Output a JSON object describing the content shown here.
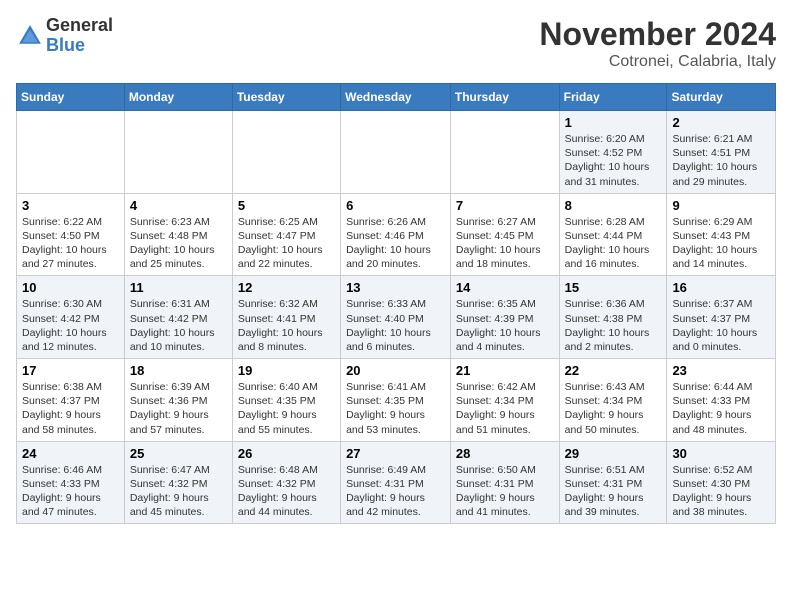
{
  "header": {
    "logo_general": "General",
    "logo_blue": "Blue",
    "month_title": "November 2024",
    "subtitle": "Cotronei, Calabria, Italy"
  },
  "days_of_week": [
    "Sunday",
    "Monday",
    "Tuesday",
    "Wednesday",
    "Thursday",
    "Friday",
    "Saturday"
  ],
  "weeks": [
    [
      {
        "day": "",
        "info": ""
      },
      {
        "day": "",
        "info": ""
      },
      {
        "day": "",
        "info": ""
      },
      {
        "day": "",
        "info": ""
      },
      {
        "day": "",
        "info": ""
      },
      {
        "day": "1",
        "info": "Sunrise: 6:20 AM\nSunset: 4:52 PM\nDaylight: 10 hours and 31 minutes."
      },
      {
        "day": "2",
        "info": "Sunrise: 6:21 AM\nSunset: 4:51 PM\nDaylight: 10 hours and 29 minutes."
      }
    ],
    [
      {
        "day": "3",
        "info": "Sunrise: 6:22 AM\nSunset: 4:50 PM\nDaylight: 10 hours and 27 minutes."
      },
      {
        "day": "4",
        "info": "Sunrise: 6:23 AM\nSunset: 4:48 PM\nDaylight: 10 hours and 25 minutes."
      },
      {
        "day": "5",
        "info": "Sunrise: 6:25 AM\nSunset: 4:47 PM\nDaylight: 10 hours and 22 minutes."
      },
      {
        "day": "6",
        "info": "Sunrise: 6:26 AM\nSunset: 4:46 PM\nDaylight: 10 hours and 20 minutes."
      },
      {
        "day": "7",
        "info": "Sunrise: 6:27 AM\nSunset: 4:45 PM\nDaylight: 10 hours and 18 minutes."
      },
      {
        "day": "8",
        "info": "Sunrise: 6:28 AM\nSunset: 4:44 PM\nDaylight: 10 hours and 16 minutes."
      },
      {
        "day": "9",
        "info": "Sunrise: 6:29 AM\nSunset: 4:43 PM\nDaylight: 10 hours and 14 minutes."
      }
    ],
    [
      {
        "day": "10",
        "info": "Sunrise: 6:30 AM\nSunset: 4:42 PM\nDaylight: 10 hours and 12 minutes."
      },
      {
        "day": "11",
        "info": "Sunrise: 6:31 AM\nSunset: 4:42 PM\nDaylight: 10 hours and 10 minutes."
      },
      {
        "day": "12",
        "info": "Sunrise: 6:32 AM\nSunset: 4:41 PM\nDaylight: 10 hours and 8 minutes."
      },
      {
        "day": "13",
        "info": "Sunrise: 6:33 AM\nSunset: 4:40 PM\nDaylight: 10 hours and 6 minutes."
      },
      {
        "day": "14",
        "info": "Sunrise: 6:35 AM\nSunset: 4:39 PM\nDaylight: 10 hours and 4 minutes."
      },
      {
        "day": "15",
        "info": "Sunrise: 6:36 AM\nSunset: 4:38 PM\nDaylight: 10 hours and 2 minutes."
      },
      {
        "day": "16",
        "info": "Sunrise: 6:37 AM\nSunset: 4:37 PM\nDaylight: 10 hours and 0 minutes."
      }
    ],
    [
      {
        "day": "17",
        "info": "Sunrise: 6:38 AM\nSunset: 4:37 PM\nDaylight: 9 hours and 58 minutes."
      },
      {
        "day": "18",
        "info": "Sunrise: 6:39 AM\nSunset: 4:36 PM\nDaylight: 9 hours and 57 minutes."
      },
      {
        "day": "19",
        "info": "Sunrise: 6:40 AM\nSunset: 4:35 PM\nDaylight: 9 hours and 55 minutes."
      },
      {
        "day": "20",
        "info": "Sunrise: 6:41 AM\nSunset: 4:35 PM\nDaylight: 9 hours and 53 minutes."
      },
      {
        "day": "21",
        "info": "Sunrise: 6:42 AM\nSunset: 4:34 PM\nDaylight: 9 hours and 51 minutes."
      },
      {
        "day": "22",
        "info": "Sunrise: 6:43 AM\nSunset: 4:34 PM\nDaylight: 9 hours and 50 minutes."
      },
      {
        "day": "23",
        "info": "Sunrise: 6:44 AM\nSunset: 4:33 PM\nDaylight: 9 hours and 48 minutes."
      }
    ],
    [
      {
        "day": "24",
        "info": "Sunrise: 6:46 AM\nSunset: 4:33 PM\nDaylight: 9 hours and 47 minutes."
      },
      {
        "day": "25",
        "info": "Sunrise: 6:47 AM\nSunset: 4:32 PM\nDaylight: 9 hours and 45 minutes."
      },
      {
        "day": "26",
        "info": "Sunrise: 6:48 AM\nSunset: 4:32 PM\nDaylight: 9 hours and 44 minutes."
      },
      {
        "day": "27",
        "info": "Sunrise: 6:49 AM\nSunset: 4:31 PM\nDaylight: 9 hours and 42 minutes."
      },
      {
        "day": "28",
        "info": "Sunrise: 6:50 AM\nSunset: 4:31 PM\nDaylight: 9 hours and 41 minutes."
      },
      {
        "day": "29",
        "info": "Sunrise: 6:51 AM\nSunset: 4:31 PM\nDaylight: 9 hours and 39 minutes."
      },
      {
        "day": "30",
        "info": "Sunrise: 6:52 AM\nSunset: 4:30 PM\nDaylight: 9 hours and 38 minutes."
      }
    ]
  ]
}
